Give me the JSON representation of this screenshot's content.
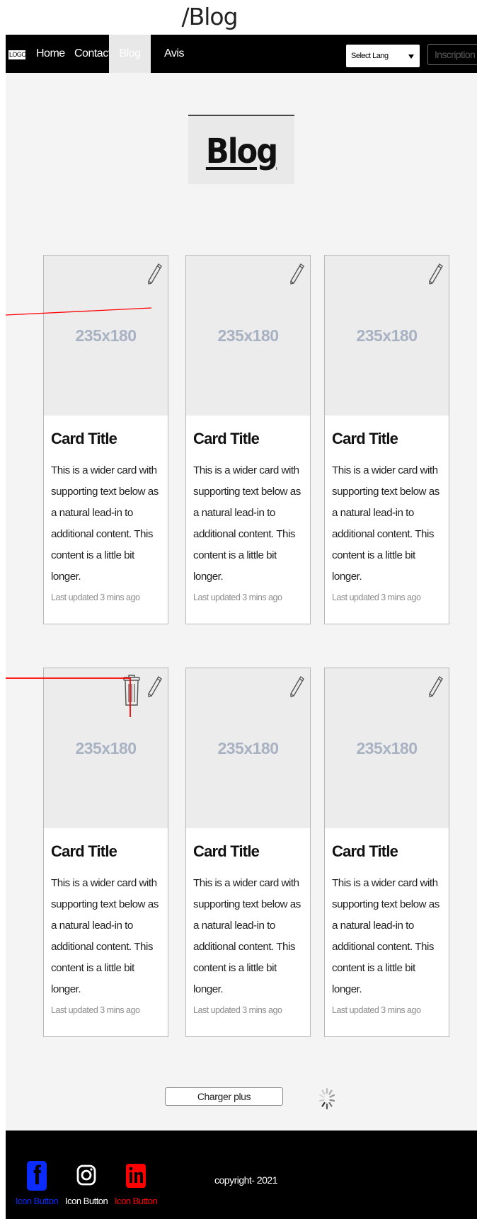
{
  "route_title": "/Blog",
  "navbar": {
    "logo": "LOGO",
    "links": [
      "Home",
      "Contact",
      "Blog",
      "Avis"
    ],
    "active": "Blog",
    "lang_select": "Select Lang",
    "signup": "Inscription"
  },
  "page": {
    "heading": "Blog"
  },
  "cards": [
    {
      "image": "235x180",
      "title": "Card Title",
      "text": "This is a wider card with supporting text below as a natural lead-in to additional content. This content is a little bit longer.",
      "updated": "Last updated 3 mins ago"
    },
    {
      "image": "235x180",
      "title": "Card Title",
      "text": "This is a wider card with supporting text below as a natural lead-in to additional content. This content is a little bit longer.",
      "updated": "Last updated 3 mins ago"
    },
    {
      "image": "235x180",
      "title": "Card Title",
      "text": "This is a wider card with supporting text below as a natural lead-in to additional content. This content is a little bit longer.",
      "updated": "Last updated 3 mins ago"
    },
    {
      "image": "235x180",
      "title": "Card Title",
      "text": "This is a wider card with supporting text below as a natural lead-in to additional content. This content is a little bit longer.",
      "updated": "Last updated 3 mins ago"
    },
    {
      "image": "235x180",
      "title": "Card Title",
      "text": "This is a wider card with supporting text below as a natural lead-in to additional content. This content is a little bit longer.",
      "updated": "Last updated 3 mins ago"
    },
    {
      "image": "235x180",
      "title": "Card Title",
      "text": "This is a wider card with supporting text below as a natural lead-in to additional content. This content is a little bit longer.",
      "updated": "Last updated 3 mins ago"
    }
  ],
  "load_more": "Charger plus",
  "footer": {
    "social": [
      {
        "icon": "facebook-icon",
        "label": "Icon Button",
        "color": "#0a2cff"
      },
      {
        "icon": "instagram-icon",
        "label": "Icon Button",
        "color": "#ffffff"
      },
      {
        "icon": "linkedin-icon",
        "label": "Icon Button",
        "color": "#ff0000"
      }
    ],
    "copyright": "copyright- 2021"
  },
  "colors": {
    "navbar_bg": "#000000",
    "page_bg": "#f4f4f4",
    "annotation": "#ff0000",
    "placeholder_text": "#a9b2c2"
  }
}
